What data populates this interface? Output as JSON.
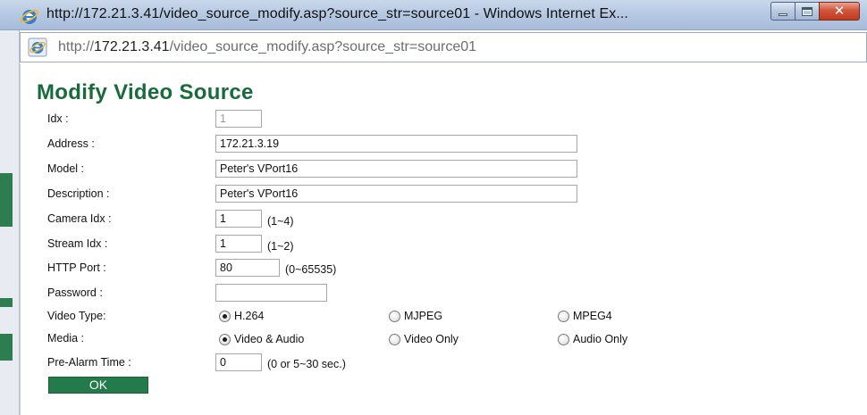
{
  "window": {
    "title": "http://172.21.3.41/video_source_modify.asp?source_str=source01 - Windows Internet Ex...",
    "close_symbol": "✕"
  },
  "address_bar": {
    "prefix": "http://",
    "host": "172.21.3.41",
    "path": "/video_source_modify.asp?source_str=source01"
  },
  "page": {
    "title": "Modify Video Source"
  },
  "form": {
    "idx": {
      "label": "Idx :",
      "value": "1"
    },
    "address": {
      "label": "Address :",
      "value": "172.21.3.19"
    },
    "model": {
      "label": "Model :",
      "value": "Peter's VPort16"
    },
    "description": {
      "label": "Description :",
      "value": "Peter's VPort16"
    },
    "camera_idx": {
      "label": "Camera Idx :",
      "value": "1",
      "hint": "(1~4)"
    },
    "stream_idx": {
      "label": "Stream Idx :",
      "value": "1",
      "hint": "(1~2)"
    },
    "http_port": {
      "label": "HTTP Port :",
      "value": "80",
      "hint": "(0~65535)"
    },
    "password": {
      "label": "Password :",
      "value": ""
    },
    "video_type": {
      "label": "Video Type:",
      "options": [
        "H.264",
        "MJPEG",
        "MPEG4"
      ],
      "selected": "H.264"
    },
    "media": {
      "label": "Media :",
      "options": [
        "Video & Audio",
        "Video Only",
        "Audio Only"
      ],
      "selected": "Video & Audio"
    },
    "pre_alarm_time": {
      "label": "Pre-Alarm Time :",
      "value": "0",
      "hint": "(0 or 5~30 sec.)"
    },
    "ok_label": "OK"
  },
  "colors": {
    "title_green": "#1a6b3c",
    "button_green": "#237a4a"
  },
  "icons": {
    "browser": "ie-icon",
    "minimize": "minimize-icon",
    "maximize": "maximize-icon",
    "close": "close-icon"
  }
}
